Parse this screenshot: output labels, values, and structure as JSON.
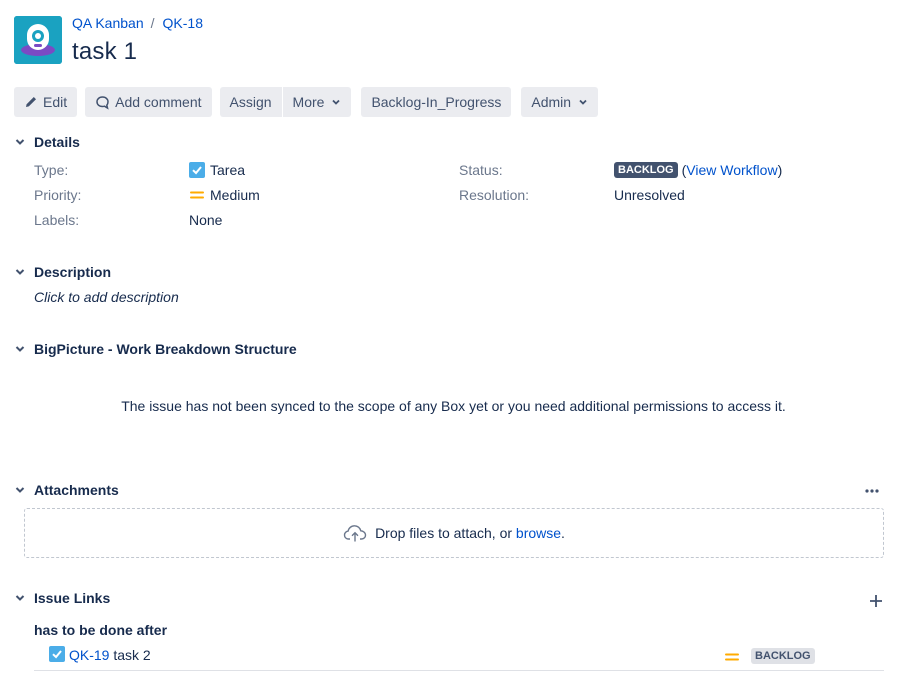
{
  "breadcrumb": {
    "project": "QA Kanban",
    "issue_key": "QK-18",
    "separator": "/"
  },
  "title": "task 1",
  "toolbar": {
    "edit": "Edit",
    "add_comment": "Add comment",
    "assign": "Assign",
    "more": "More",
    "transition": "Backlog-In_Progress",
    "admin": "Admin"
  },
  "details": {
    "heading": "Details",
    "type_label": "Type:",
    "type_value": "Tarea",
    "priority_label": "Priority:",
    "priority_value": "Medium",
    "labels_label": "Labels:",
    "labels_value": "None",
    "status_label": "Status:",
    "status_value": "BACKLOG",
    "view_workflow_open": "(",
    "view_workflow": "View Workflow",
    "view_workflow_close": ")",
    "resolution_label": "Resolution:",
    "resolution_value": "Unresolved"
  },
  "description": {
    "heading": "Description",
    "placeholder": "Click to add description"
  },
  "bigpicture": {
    "heading": "BigPicture - Work Breakdown Structure",
    "message": "The issue has not been synced to the scope of any Box yet or you need additional permissions to access it."
  },
  "attachments": {
    "heading": "Attachments",
    "drop_text": "Drop files to attach, or ",
    "browse": "browse",
    "period": "."
  },
  "issue_links": {
    "heading": "Issue Links",
    "link_type": "has to be done after",
    "items": [
      {
        "key": "QK-19",
        "summary": "task 2",
        "status": "BACKLOG"
      }
    ]
  },
  "colors": {
    "link": "#0052cc",
    "task_icon": "#4bade8",
    "priority_medium": "#ffab00",
    "status_dark": "#42526e"
  },
  "icons": [
    "project-avatar",
    "pencil-icon",
    "comment-icon",
    "chevron-down-icon",
    "task-type-icon",
    "priority-medium-icon",
    "more-icon",
    "upload-cloud-icon",
    "add-icon"
  ]
}
